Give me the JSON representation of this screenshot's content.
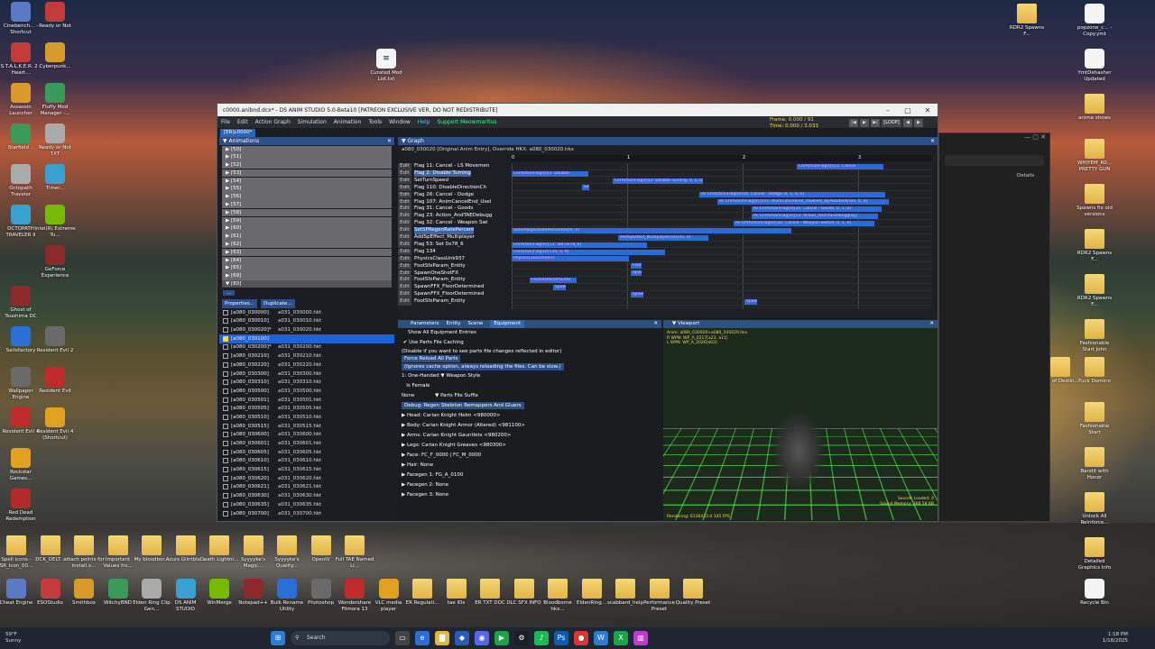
{
  "window": {
    "title": "c0000.anibnd.dcx* - DS ANIM STUDIO 5.0-Beta10 [PATREON EXCLUSIVE VER, DO NOT REDISTRIBUTE]",
    "menu": [
      "File",
      "Edit",
      "Action Graph",
      "Simulation",
      "Animation",
      "Tools",
      "Window",
      "Help",
      "Support Meowmaritus"
    ],
    "frame_label": "Frame:",
    "frame_value": "0.000 / 91",
    "time_label": "Time:",
    "time_value": "0.000 / 3.033",
    "loop_label": "[LOOP]",
    "doc_tab": "[ER]c0000*"
  },
  "animations": {
    "header": "Animations",
    "groups": [
      "[50]",
      "[51]",
      "[52]",
      "[53]",
      "[54]",
      "[55]",
      "[56]",
      "[57]",
      "[58]",
      "[59]",
      "[60]",
      "[61]",
      "[62]",
      "[63]",
      "[64]",
      "[65]",
      "[69]",
      "[80]"
    ],
    "more": "...",
    "properties_btn": "Properties...",
    "duplicate_btn": "Duplicate...",
    "files": [
      [
        "[a080_030000]",
        "a031_030000.hkt"
      ],
      [
        "[a080_030010]",
        "a031_030010.hkt"
      ],
      [
        "[a080_030020]*",
        "a031_030020.hkt"
      ],
      [
        "[a080_030100]",
        ""
      ],
      [
        "[a080_030200]*",
        "a031_030200.hkt"
      ],
      [
        "[a080_030210]",
        "a031_030210.hkt"
      ],
      [
        "[a080_030220]",
        "a031_030220.hkt"
      ],
      [
        "[a080_030300]",
        "a031_030300.hkt"
      ],
      [
        "[a080_030310]",
        "a031_030310.hkt"
      ],
      [
        "[a080_030500]",
        "a031_030500.hkt"
      ],
      [
        "[a080_030501]",
        "a031_030501.hkt"
      ],
      [
        "[a080_030505]",
        "a031_030505.hkt"
      ],
      [
        "[a080_030510]",
        "a031_030510.hkt"
      ],
      [
        "[a080_030515]",
        "a031_030515.hkt"
      ],
      [
        "[a080_030600]",
        "a031_030600.hkt"
      ],
      [
        "[a080_030601]",
        "a031_030601.hkt"
      ],
      [
        "[a080_030605]",
        "a031_030605.hkt"
      ],
      [
        "[a080_030610]",
        "a031_030610.hkt"
      ],
      [
        "[a080_030615]",
        "a031_030615.hkt"
      ],
      [
        "[a080_030620]",
        "a031_030620.hkt"
      ],
      [
        "[a080_030621]",
        "a031_030621.hkt"
      ],
      [
        "[a080_030630]",
        "a031_030630.hkt"
      ],
      [
        "[a080_030635]",
        "a031_030635.hkt"
      ],
      [
        "[a080_030700]",
        "a031_030700.hkt"
      ]
    ]
  },
  "graph": {
    "header": "Graph",
    "title": "a080_030020 [Original Anim Entry], Override HKX: a080_030020.hkx",
    "ruler": [
      "0",
      "1",
      "2",
      "3"
    ],
    "edit_label": "Edit",
    "tracks": [
      "Flag 11: Cancel - LS Movemen",
      "Flag 2: Disable Turning",
      "SetTurnSpeed",
      "Flag 110: DisableDirectionCh",
      "Flag 26: Cancel - Dodge",
      "Flag 107: AnimCancelEnd_UseI",
      "Flag 31: Cancel - Goods",
      "Flag 23: Action_AndTAEDebugg",
      "Flag 32: Cancel - Weapon Swi",
      "SetSPRegenRatePercent",
      "AddSpEffect_Multiplayer",
      "Flag 53: Set 0x78_6",
      "Flag 134",
      "PhysicsClassUnk937",
      "FootSfxParam_Entity",
      "SpawnOneShotFX",
      "FootSfxParam_Entity",
      "SpawnFFX_FloorDetermined",
      "SpawnFFX_FloorDetermined",
      "FootSfxParam_Entity"
    ],
    "events": [
      "ChrActionFlag(0)[11: Cancel",
      "ChrActionFlag(0)[2: Disable",
      "ChrActionFlag(0)[2: Disable Turning, 0, 1, 0, 0]",
      "Se",
      "Ac ChrActionFlag(0)[26: Cancel - Dodge, 0, 1, 0, 0]",
      "Ac ChrActionFlag(0)[107: AnimCancelEnd_UseItem_ByAwaitsParam, 0, 0]",
      "Ac ChrActionFlag(0)[31: Cancel - Goods, 0, 1, 0]",
      "Ac ChrActionFlag(0)[23: Action_AndTAEDebugging]",
      "Ac ChrActionFlag(0)[32: Cancel - Weapon Switch, 0, 1, 0]",
      "SetSPRegenRatePercent(0)[0, 0]",
      "AddSpEffect_Multiplayer(s4)[45, 0]",
      "ChrActionFlag(0)[53: Set 0x78_6]",
      "ChrActionFlag(0)[134, 0, 0]",
      "PhysicsClassUnk937",
      "Foot",
      "Spaw",
      "FootSfxParam(Entit",
      "Spaw",
      "Spaw",
      "Spaw"
    ]
  },
  "equipment": {
    "tabs": [
      "Parameters",
      "Entity",
      "Scene",
      "Equipment"
    ],
    "show_all": "Show All Equipment Entries",
    "use_parts": "Use Parts File Caching",
    "use_parts_note": "(Disable if you want to see parts file changes reflected in editor)",
    "force_reload": "Force Reload All Parts",
    "force_reload_note": "(Ignores cache option, always reloading the files. Can be slow.)",
    "one_handed": "1: One-Handed",
    "weapon_style": "Weapon Style",
    "is_female": "Is Female",
    "suffix_value": "None",
    "suffix_label": "Parts File Suffix",
    "debug": "Debug: Regen Skeleton Remappers And Gluers",
    "items": [
      "Head: Carian Knight Helm <980000>",
      "Body: Carian Knight Armor (Altered) <981100>",
      "Arms: Carian Knight Gauntlets <980200>",
      "Legs: Carian Knight Greaves <980300>",
      "Face: FC_F_0000 | FC_M_0000",
      "Hair: None",
      "Facegen 1: FG_A_0100",
      "Facegen 2: None",
      "Facegen 3: None"
    ]
  },
  "viewport": {
    "header": "Viewport",
    "info": [
      "Anim: a080_030020>a080_030020.hkx",
      "R WPN: WP_A_0217[a23, a11]",
      "L WPN: WP_A_2026[a03]"
    ],
    "stats": [
      "Sounds Loaded: 0",
      "Sound Memory: 368.58 KB"
    ],
    "render": "Rendering: 6136433.0 145 FPS"
  },
  "desktop_left": [
    [
      "Cinebench... - Shortcut",
      "Ready or Not"
    ],
    [
      "S.T.A.L.K.E.R. 2 - Heart...",
      "Cyberpunk..."
    ],
    [
      "Assassin Launcher",
      "Fluffy Mod Manager -..."
    ],
    [
      "Starfield ..",
      "Ready or Not TXT"
    ],
    [
      "Octopath Traveler",
      "Timer..."
    ],
    [
      "OCTOPATH TRAVELER II",
      "Intel(R) Extreme Tu..."
    ],
    [
      "",
      "GeForce Experience"
    ],
    [
      "Ghost of Tsushima DC",
      ""
    ],
    [
      "Satisfactory",
      "Resident Evil 2"
    ],
    [
      "Wallpaper Engine",
      "Resident Evil"
    ],
    [
      "Resident Evil 4",
      "Resident Evil 4 (Shortcut)"
    ],
    [
      "Rockstar Games...",
      ""
    ],
    [
      "Red Dead Redemption",
      ""
    ]
  ],
  "desktop_bottom": [
    "Spell icons -SR_Icon_00...",
    "DCK_DELT...",
    "attach points for install.x...",
    "Important Values fro...",
    "My bloodbor...",
    "Azurs Glintbla...",
    "Death Lightni...",
    "Syyyyke's Magic...",
    "Syyyyke's Quality...",
    "OpenIV",
    "Full TAE Named Li..."
  ],
  "desktop_bottom2": [
    "Cheat Engine",
    "ESOStudio",
    "Smithbox",
    "WitchyBND",
    "Elden Ring Clip Gen...",
    "DS ANIM STUDIO",
    "WinMerge",
    "Notepad++",
    "Bulk Rename Utility",
    "Photoshop",
    "Wondershare Filmora 13",
    "VLC media player",
    "ER Regulati...",
    "tae IDs",
    "ER TXT DOC",
    "DLC SFX INFO",
    "Bloodborne hkx...",
    "EldenRing...",
    "scabbard_help",
    "Performance Preset",
    "Quality Preset"
  ],
  "desktop_top": [
    "Curated Mod List.txt"
  ],
  "desktop_right": [
    "RDR2 Spawns F...",
    "popzone_c... - Copy.ymt",
    "YmtDehasher Updated",
    "anime shows",
    "WHIYEM_R0... PRETTY GUN",
    "Spawns fix old versions",
    "RDR2 Spawns F...",
    "RDR2 Spawns F...",
    "Fashionable Start John",
    "Veil of Destin...",
    "Fuck Domino",
    "Fashionable Start",
    "Bandit with Honor",
    "Unlock All Reinforce...",
    "Detailed Graphics Info",
    "Recycle Bin"
  ],
  "win2": {
    "details": "Details"
  },
  "taskbar": {
    "weather_temp": "59°F",
    "weather_desc": "Sunny",
    "search": "Search",
    "time": "1:18 PM",
    "date": "1/18/2025"
  }
}
